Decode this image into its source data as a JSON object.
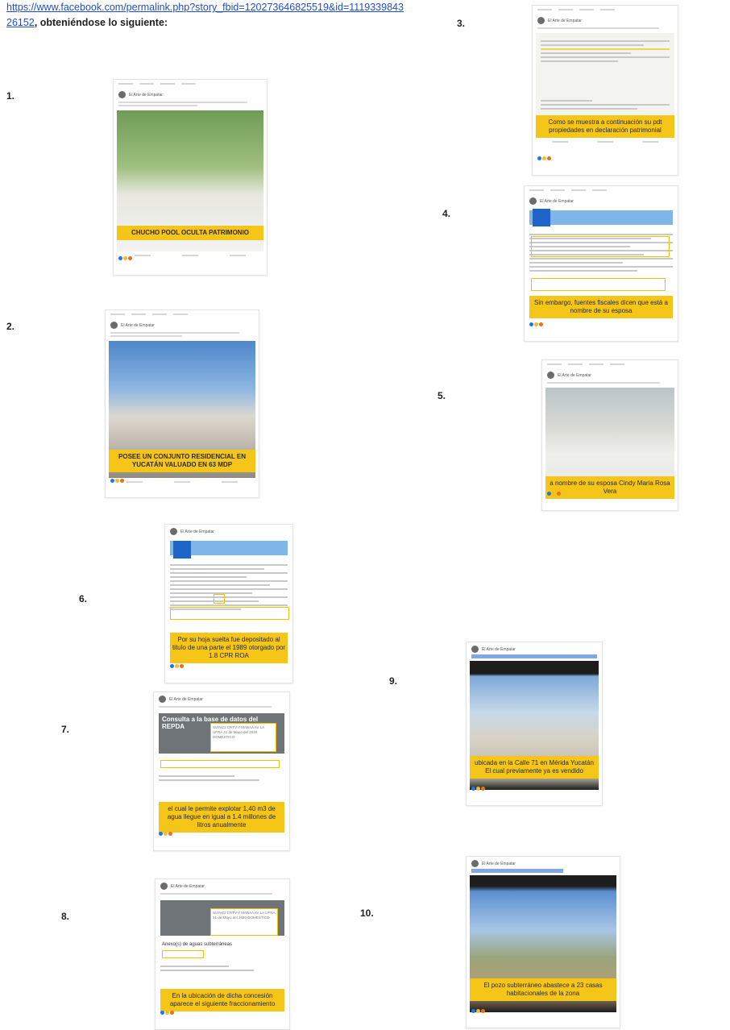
{
  "intro": {
    "link": "https://www.facebook.com/permalink.php?story_fbid=120273646825519&id=1119339843 26152",
    "suffix": ", obteniéndose lo siguiente:"
  },
  "items": [
    {
      "num": "1.",
      "caption": "CHUCHO POOL OCULTA PATRIMONIO"
    },
    {
      "num": "2.",
      "caption": "POSEE UN CONJUNTO RESIDENCIAL EN YUCATÁN VALUADO EN 63 MDP"
    },
    {
      "num": "3.",
      "caption": "Como se muestra a continuación su pdt propiedades en declaración patrimonial"
    },
    {
      "num": "4.",
      "caption": "Sin embargo, fuentes fiscales dicen que está a nombre de su esposa"
    },
    {
      "num": "5.",
      "caption": "a nombre de su esposa Cindy Maria Rosa Vera"
    },
    {
      "num": "6.",
      "caption": "Por su hoja suelta fue depositado al titulo de una parte el 1989 otorgado por 1.8 CPR ROA"
    },
    {
      "num": "7.",
      "caption": "el cual le permite explotar 1,40 m3 de agua llegue en igual a 1.4 millones de litros anualmente",
      "banner": "Consulta a la base de datos del REPDA",
      "boxtext": "SUYACI CRTV-Y MABAA AV LA UFRA 31 de Mayo del 2020 DOMESTICO"
    },
    {
      "num": "8.",
      "caption": "En la ubicación de dicha concesión aparece el siguiente fraccionamiento",
      "boxtext": "SUYACI CRTV-Y MABAA AV LA UFRA 31 de Mayo del 2020 DOMESTICO",
      "section": "Anexo(s) de aguas subterráneas"
    },
    {
      "num": "9.",
      "caption": "ubicada en la Calle 71 en Mérida Yucatán El cual previamente ya es vendido"
    },
    {
      "num": "10.",
      "caption": "El pozo subterráneo abastece a 23 casas habitacionales de la zona"
    }
  ]
}
